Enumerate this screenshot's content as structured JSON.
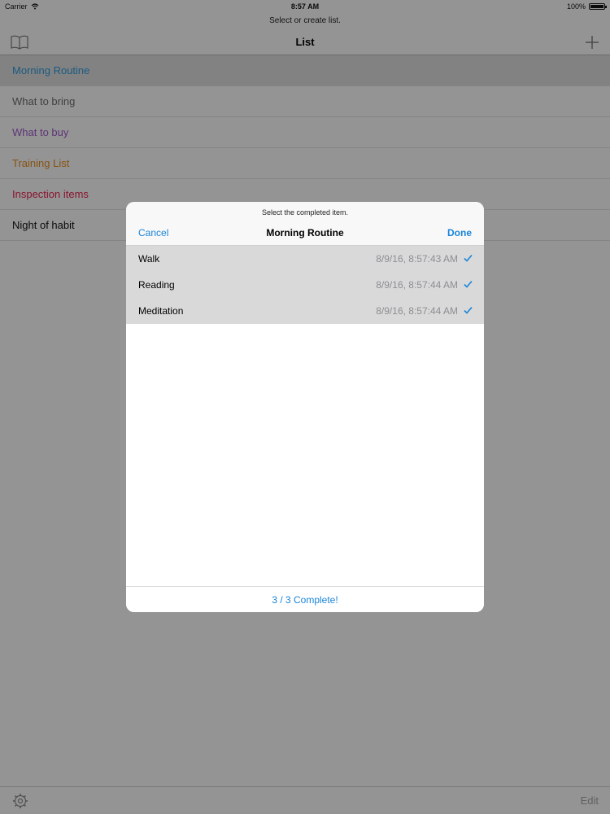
{
  "statusbar": {
    "carrier": "Carrier",
    "time": "8:57 AM",
    "battery": "100%"
  },
  "prompt": "Select or create list.",
  "navbar": {
    "title": "List",
    "left_icon": "book-icon",
    "right_icon": "plus-icon"
  },
  "lists": [
    {
      "label": "Morning Routine",
      "color": "#2d97d6",
      "selected": true
    },
    {
      "label": "What to bring",
      "color": "#6b6b6b"
    },
    {
      "label": "What to buy",
      "color": "#9b59c6"
    },
    {
      "label": "Training List",
      "color": "#e08a1e"
    },
    {
      "label": "Inspection items",
      "color": "#e5234e"
    },
    {
      "label": "Night of habit",
      "color": "#111111"
    }
  ],
  "toolbar": {
    "settings_icon": "gear-icon",
    "edit_label": "Edit"
  },
  "sheet": {
    "prompt": "Select the completed item.",
    "title": "Morning Routine",
    "cancel_label": "Cancel",
    "done_label": "Done",
    "items": [
      {
        "name": "Walk",
        "time": "8/9/16, 8:57:43 AM",
        "checked": true
      },
      {
        "name": "Reading",
        "time": "8/9/16, 8:57:44 AM",
        "checked": true
      },
      {
        "name": "Meditation",
        "time": "8/9/16, 8:57:44 AM",
        "checked": true
      }
    ],
    "status": "3 / 3 Complete!"
  },
  "colors": {
    "accent": "#1a84d8"
  }
}
